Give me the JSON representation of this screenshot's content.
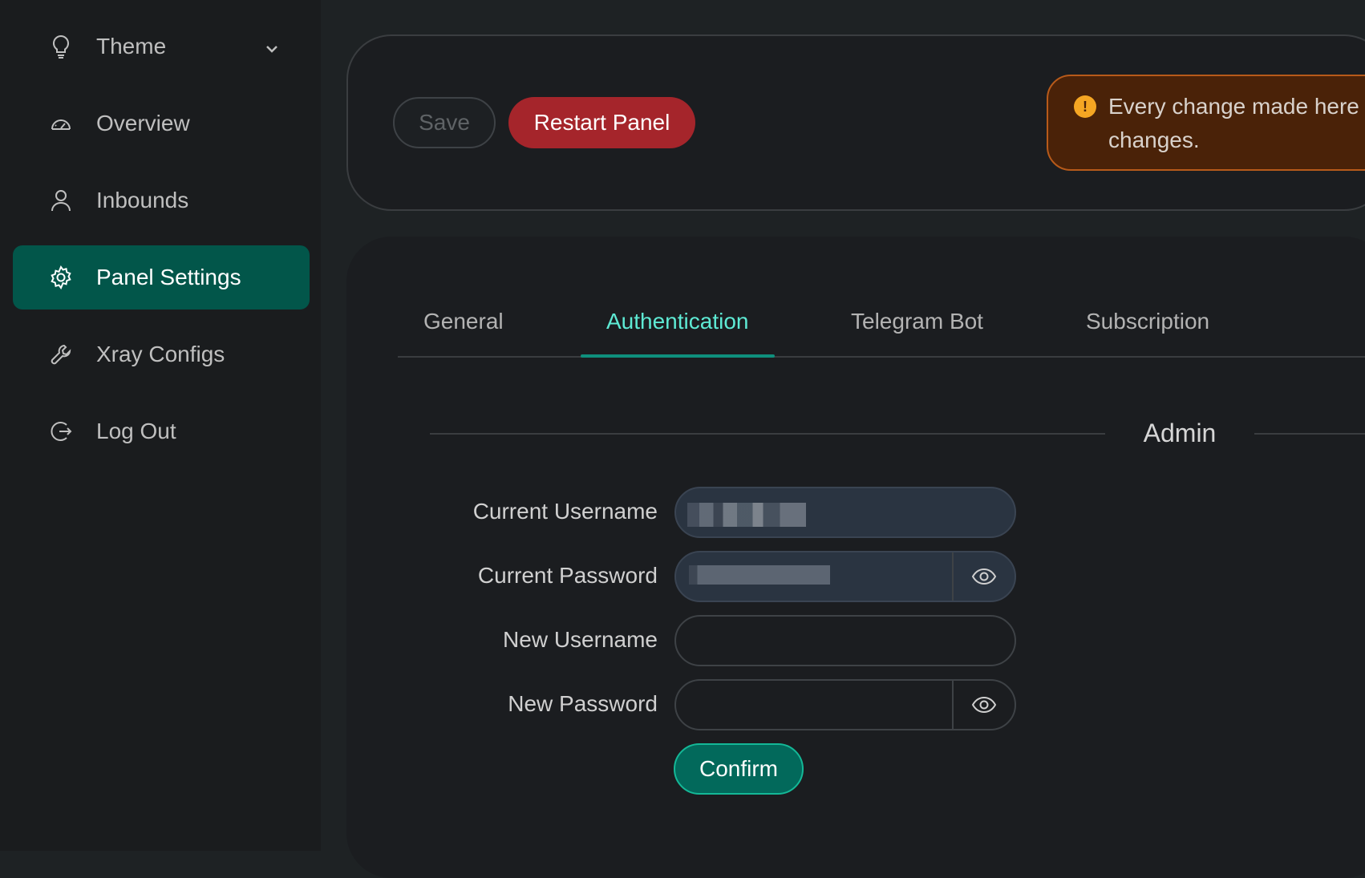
{
  "sidebar": {
    "items": [
      {
        "label": "Theme",
        "icon": "lightbulb-icon"
      },
      {
        "label": "Overview",
        "icon": "dashboard-icon"
      },
      {
        "label": "Inbounds",
        "icon": "user-icon"
      },
      {
        "label": "Panel Settings",
        "icon": "gear-icon",
        "active": true
      },
      {
        "label": "Xray Configs",
        "icon": "wrench-icon"
      },
      {
        "label": "Log Out",
        "icon": "logout-icon"
      }
    ]
  },
  "toolbar": {
    "save_label": "Save",
    "restart_label": "Restart Panel"
  },
  "alert": {
    "message": "Every change made here changes."
  },
  "tabs": [
    {
      "label": "General"
    },
    {
      "label": "Authentication",
      "active": true
    },
    {
      "label": "Telegram Bot"
    },
    {
      "label": "Subscription"
    }
  ],
  "section": {
    "title": "Admin"
  },
  "form": {
    "current_username_label": "Current Username",
    "current_password_label": "Current Password",
    "new_username_label": "New Username",
    "new_password_label": "New Password",
    "confirm_label": "Confirm"
  },
  "colors": {
    "accent": "#02564a",
    "tab_active": "#5eead4",
    "danger": "#a5252b",
    "warning": "#f5a623"
  }
}
